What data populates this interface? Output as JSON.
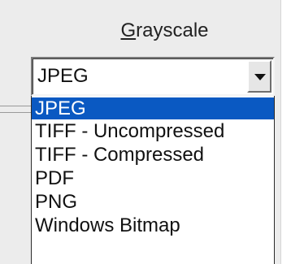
{
  "group_label": {
    "mnemonic": "G",
    "rest": "rayscale"
  },
  "format_select": {
    "value": "JPEG",
    "options": [
      {
        "label": "JPEG",
        "selected": true
      },
      {
        "label": "TIFF - Uncompressed"
      },
      {
        "label": "TIFF - Compressed"
      },
      {
        "label": "PDF"
      },
      {
        "label": "PNG"
      },
      {
        "label": "Windows Bitmap"
      }
    ]
  },
  "colors": {
    "selection": "#0a59c2",
    "panel": "#ececec"
  },
  "icons": {
    "dropdown": "chevron-down-icon"
  }
}
